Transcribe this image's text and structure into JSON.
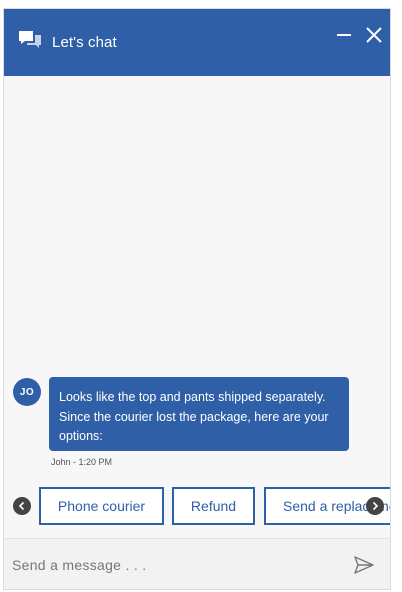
{
  "header": {
    "title": "Let's chat",
    "icons": [
      "chat-bubbles-icon",
      "minimize-icon",
      "close-icon"
    ],
    "color": "#2f5fa7"
  },
  "message": {
    "avatar_initials": "JO",
    "text": "Looks like the top and pants shipped separately. Since the courier lost the package, here are your options:",
    "sender": "John",
    "time": "1:20 PM",
    "meta": "John - 1:20 PM"
  },
  "quick_replies": [
    {
      "label": "Phone courier"
    },
    {
      "label": "Refund"
    },
    {
      "label": "Send a replacement"
    }
  ],
  "scroll": {
    "left_icon": "chevron-left-icon",
    "right_icon": "chevron-right-icon"
  },
  "composer": {
    "placeholder": "Send a message . . .",
    "value": "",
    "send_icon": "send-icon"
  }
}
